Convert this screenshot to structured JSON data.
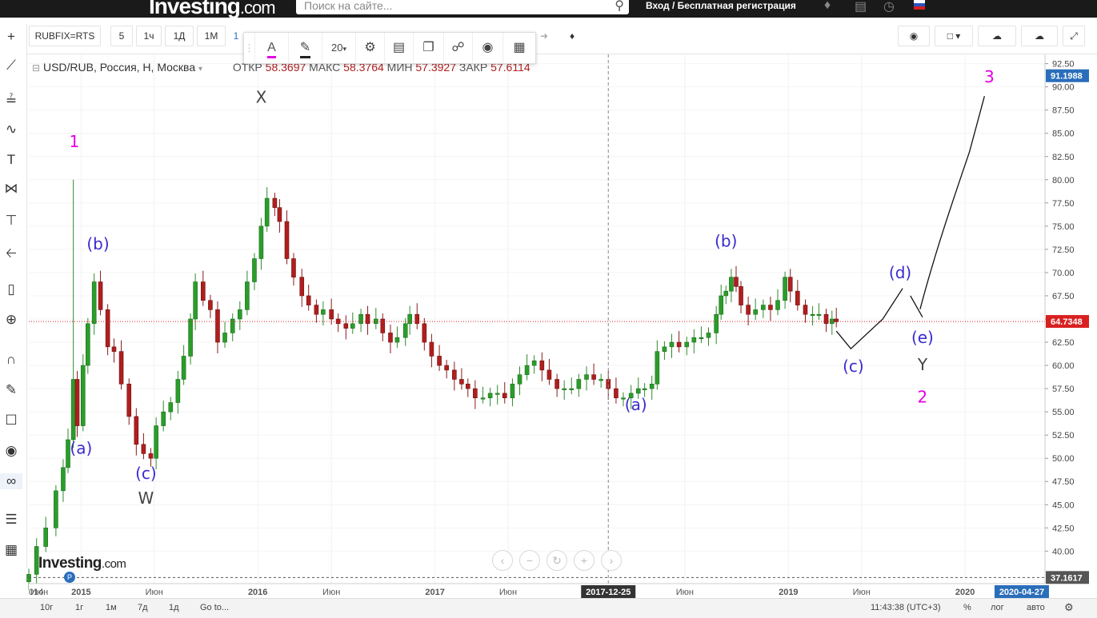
{
  "site": {
    "logo": "Investing",
    "logo_suffix": ".com",
    "search_placeholder": "Поиск на сайте...",
    "auth": "Вход / Бесплатная регистрация"
  },
  "toolbar": {
    "symbol": "RUBFIX=RTS",
    "intervals": [
      "5",
      "1ч",
      "1Д",
      "1М"
    ],
    "interval_partial": "1"
  },
  "drawing_tools": {
    "font_size": "20",
    "text_color": "#e600e6"
  },
  "legend": {
    "title": "USD/RUB, Россия, H, Москва",
    "open_label": "ОТКР",
    "open": "58.3697",
    "high_label": "МАКС",
    "high": "58.3764",
    "low_label": "МИН",
    "low": "57.3927",
    "close_label": "ЗАКР",
    "close": "57.6114"
  },
  "watermark": {
    "text": "Investing",
    "suffix": ".com",
    "badge": "P"
  },
  "bottom": {
    "ranges": [
      "10г",
      "1г",
      "1м",
      "7д",
      "1д"
    ],
    "goto": "Go to...",
    "time": "11:43:38 (UTC+3)",
    "pct": "%",
    "log": "лог",
    "auto": "авто"
  },
  "chart_data": {
    "type": "candlestick",
    "title": "",
    "y_range": [
      36.5,
      93.5
    ],
    "y_ticks": [
      40,
      42.5,
      45,
      47.5,
      50,
      52.5,
      55,
      57.5,
      60,
      62.5,
      65,
      67.5,
      70,
      72.5,
      75,
      77.5,
      80,
      82.5,
      85,
      87.5,
      90,
      92.5
    ],
    "y_badges": [
      {
        "value": 91.1988,
        "text": "91.1988",
        "color": "#2a6ebb"
      },
      {
        "value": 64.7348,
        "text": "64.7348",
        "color": "#d92020"
      },
      {
        "value": 37.1617,
        "text": "37.1617",
        "color": "#555555"
      }
    ],
    "current_price": 64.7348,
    "x_range": [
      "2014-09-15",
      "2020-06-14"
    ],
    "x_ticks": [
      {
        "date": "2014-09-15",
        "text": "014",
        "bold": false
      },
      {
        "date": "2014-07-01",
        "text": "Июн",
        "bold": false
      },
      {
        "date": "2015-01-01",
        "text": "2015",
        "bold": true
      },
      {
        "date": "2015-06-01",
        "text": "Июн",
        "bold": false
      },
      {
        "date": "2016-01-01",
        "text": "2016",
        "bold": true
      },
      {
        "date": "2016-06-01",
        "text": "Июн",
        "bold": false
      },
      {
        "date": "2017-01-01",
        "text": "2017",
        "bold": true
      },
      {
        "date": "2017-06-01",
        "text": "Июн",
        "bold": false
      },
      {
        "date": "2018-06-01",
        "text": "Июн",
        "bold": false
      },
      {
        "date": "2019-01-01",
        "text": "2019",
        "bold": true
      },
      {
        "date": "2019-06-01",
        "text": "Июн",
        "bold": false
      },
      {
        "date": "2020-01-01",
        "text": "2020",
        "bold": true
      }
    ],
    "x_badges": [
      {
        "date": "2017-12-25",
        "text": "2017-12-25",
        "color": "#333333"
      },
      {
        "date": "2020-04-27",
        "text": "2020-04-27",
        "color": "#2a6ebb"
      }
    ],
    "crosshair_date": "2017-12-25",
    "candles_weekly_close": [
      {
        "date": "2014-09-15",
        "v": 37.5
      },
      {
        "date": "2014-10-01",
        "v": 40.5
      },
      {
        "date": "2014-10-20",
        "v": 42.5
      },
      {
        "date": "2014-11-10",
        "v": 46.5
      },
      {
        "date": "2014-11-25",
        "v": 49.0
      },
      {
        "date": "2014-12-05",
        "v": 52.0
      },
      {
        "date": "2014-12-16",
        "v": 58.5
      },
      {
        "date": "2014-12-24",
        "v": 53.5
      },
      {
        "date": "2015-01-05",
        "v": 60.0
      },
      {
        "date": "2015-01-15",
        "v": 64.5
      },
      {
        "date": "2015-01-28",
        "v": 69.0
      },
      {
        "date": "2015-02-10",
        "v": 66.0
      },
      {
        "date": "2015-02-25",
        "v": 62.0
      },
      {
        "date": "2015-03-10",
        "v": 61.5
      },
      {
        "date": "2015-03-25",
        "v": 58.0
      },
      {
        "date": "2015-04-10",
        "v": 54.5
      },
      {
        "date": "2015-04-25",
        "v": 51.5
      },
      {
        "date": "2015-05-10",
        "v": 50.5
      },
      {
        "date": "2015-05-25",
        "v": 50.0
      },
      {
        "date": "2015-06-05",
        "v": 53.5
      },
      {
        "date": "2015-06-20",
        "v": 55.0
      },
      {
        "date": "2015-07-05",
        "v": 56.0
      },
      {
        "date": "2015-07-20",
        "v": 58.5
      },
      {
        "date": "2015-08-01",
        "v": 61.0
      },
      {
        "date": "2015-08-15",
        "v": 65.0
      },
      {
        "date": "2015-08-25",
        "v": 69.0
      },
      {
        "date": "2015-09-10",
        "v": 67.0
      },
      {
        "date": "2015-09-25",
        "v": 66.0
      },
      {
        "date": "2015-10-10",
        "v": 62.5
      },
      {
        "date": "2015-10-25",
        "v": 63.5
      },
      {
        "date": "2015-11-10",
        "v": 65.0
      },
      {
        "date": "2015-11-25",
        "v": 66.0
      },
      {
        "date": "2015-12-10",
        "v": 69.0
      },
      {
        "date": "2015-12-25",
        "v": 71.5
      },
      {
        "date": "2016-01-08",
        "v": 75.0
      },
      {
        "date": "2016-01-20",
        "v": 78.0
      },
      {
        "date": "2016-02-05",
        "v": 77.0
      },
      {
        "date": "2016-02-15",
        "v": 75.5
      },
      {
        "date": "2016-03-01",
        "v": 71.5
      },
      {
        "date": "2016-03-15",
        "v": 69.5
      },
      {
        "date": "2016-04-01",
        "v": 67.5
      },
      {
        "date": "2016-04-15",
        "v": 66.5
      },
      {
        "date": "2016-05-01",
        "v": 65.5
      },
      {
        "date": "2016-05-15",
        "v": 66.0
      },
      {
        "date": "2016-06-01",
        "v": 65.0
      },
      {
        "date": "2016-06-15",
        "v": 64.5
      },
      {
        "date": "2016-07-01",
        "v": 64.0
      },
      {
        "date": "2016-07-15",
        "v": 64.5
      },
      {
        "date": "2016-08-01",
        "v": 65.5
      },
      {
        "date": "2016-08-15",
        "v": 64.5
      },
      {
        "date": "2016-09-01",
        "v": 65.0
      },
      {
        "date": "2016-09-15",
        "v": 63.5
      },
      {
        "date": "2016-10-01",
        "v": 62.5
      },
      {
        "date": "2016-10-15",
        "v": 63.0
      },
      {
        "date": "2016-11-01",
        "v": 64.5
      },
      {
        "date": "2016-11-10",
        "v": 65.5
      },
      {
        "date": "2016-11-25",
        "v": 64.5
      },
      {
        "date": "2016-12-10",
        "v": 62.5
      },
      {
        "date": "2016-12-25",
        "v": 61.0
      },
      {
        "date": "2017-01-10",
        "v": 60.0
      },
      {
        "date": "2017-01-25",
        "v": 59.5
      },
      {
        "date": "2017-02-10",
        "v": 58.5
      },
      {
        "date": "2017-02-25",
        "v": 58.0
      },
      {
        "date": "2017-03-10",
        "v": 57.5
      },
      {
        "date": "2017-03-25",
        "v": 56.5
      },
      {
        "date": "2017-04-10",
        "v": 56.5
      },
      {
        "date": "2017-04-25",
        "v": 57.0
      },
      {
        "date": "2017-05-10",
        "v": 57.0
      },
      {
        "date": "2017-05-25",
        "v": 56.5
      },
      {
        "date": "2017-06-10",
        "v": 58.0
      },
      {
        "date": "2017-06-25",
        "v": 59.0
      },
      {
        "date": "2017-07-10",
        "v": 60.0
      },
      {
        "date": "2017-07-25",
        "v": 60.5
      },
      {
        "date": "2017-08-10",
        "v": 59.5
      },
      {
        "date": "2017-08-25",
        "v": 58.5
      },
      {
        "date": "2017-09-10",
        "v": 57.5
      },
      {
        "date": "2017-09-25",
        "v": 57.5
      },
      {
        "date": "2017-10-10",
        "v": 57.5
      },
      {
        "date": "2017-10-25",
        "v": 58.5
      },
      {
        "date": "2017-11-10",
        "v": 59.0
      },
      {
        "date": "2017-11-25",
        "v": 58.5
      },
      {
        "date": "2017-12-10",
        "v": 58.5
      },
      {
        "date": "2017-12-25",
        "v": 57.5
      },
      {
        "date": "2018-01-10",
        "v": 56.5
      },
      {
        "date": "2018-01-25",
        "v": 56.5
      },
      {
        "date": "2018-02-10",
        "v": 57.0
      },
      {
        "date": "2018-02-25",
        "v": 57.5
      },
      {
        "date": "2018-03-10",
        "v": 57.5
      },
      {
        "date": "2018-03-25",
        "v": 58.0
      },
      {
        "date": "2018-04-05",
        "v": 61.5
      },
      {
        "date": "2018-04-20",
        "v": 62.0
      },
      {
        "date": "2018-05-05",
        "v": 62.5
      },
      {
        "date": "2018-05-20",
        "v": 62.0
      },
      {
        "date": "2018-06-05",
        "v": 62.5
      },
      {
        "date": "2018-06-20",
        "v": 63.0
      },
      {
        "date": "2018-07-05",
        "v": 63.0
      },
      {
        "date": "2018-07-20",
        "v": 63.5
      },
      {
        "date": "2018-08-05",
        "v": 65.5
      },
      {
        "date": "2018-08-15",
        "v": 67.5
      },
      {
        "date": "2018-08-25",
        "v": 68.0
      },
      {
        "date": "2018-09-05",
        "v": 69.5
      },
      {
        "date": "2018-09-15",
        "v": 68.5
      },
      {
        "date": "2018-09-25",
        "v": 66.5
      },
      {
        "date": "2018-10-10",
        "v": 65.5
      },
      {
        "date": "2018-10-25",
        "v": 66.0
      },
      {
        "date": "2018-11-10",
        "v": 66.5
      },
      {
        "date": "2018-11-25",
        "v": 66.0
      },
      {
        "date": "2018-12-10",
        "v": 67.0
      },
      {
        "date": "2018-12-25",
        "v": 69.5
      },
      {
        "date": "2019-01-05",
        "v": 68.0
      },
      {
        "date": "2019-01-20",
        "v": 66.5
      },
      {
        "date": "2019-02-05",
        "v": 65.5
      },
      {
        "date": "2019-02-20",
        "v": 65.5
      },
      {
        "date": "2019-03-05",
        "v": 65.5
      },
      {
        "date": "2019-03-20",
        "v": 64.5
      },
      {
        "date": "2019-04-01",
        "v": 65.0
      },
      {
        "date": "2019-04-10",
        "v": 64.7
      }
    ],
    "price_spikes": [
      {
        "date": "2014-12-16",
        "high": 80.0,
        "low": 51.5
      },
      {
        "date": "2015-01-30",
        "high": 72.0,
        "low": 64.0
      },
      {
        "date": "2016-01-21",
        "high": 86.0,
        "low": 74.5
      }
    ],
    "wave_path": [
      {
        "date": "2019-04-10",
        "v": 63.7
      },
      {
        "date": "2019-05-10",
        "v": 61.8
      },
      {
        "date": "2019-07-15",
        "v": 65.0
      },
      {
        "date": "2019-08-25",
        "v": 68.3
      },
      {
        "date": "2019-09-10",
        "v": 67.5
      },
      {
        "date": "2019-10-05",
        "v": 65.2
      },
      {
        "date": "2019-10-30",
        "v": 72.0
      },
      {
        "date": "2019-12-05",
        "v": 77.5
      },
      {
        "date": "2020-01-10",
        "v": 83.0
      },
      {
        "date": "2020-02-10",
        "v": 89.0
      }
    ],
    "annotations": [
      {
        "text": "1",
        "date": "2014-12-18",
        "v": 83.5,
        "color": "#e600e6"
      },
      {
        "text": "(b)",
        "date": "2015-02-05",
        "v": 72.5,
        "color": "#3a2ad0"
      },
      {
        "text": "(a)",
        "date": "2015-01-01",
        "v": 50.5,
        "color": "#3a2ad0"
      },
      {
        "text": "(c)",
        "date": "2015-05-15",
        "v": 47.8,
        "color": "#3a2ad0"
      },
      {
        "text": "W",
        "date": "2015-05-15",
        "v": 45.1,
        "color": "#444444"
      },
      {
        "text": "X",
        "date": "2016-01-08",
        "v": 88.3,
        "color": "#444444"
      },
      {
        "text": "(a)",
        "date": "2018-02-20",
        "v": 55.2,
        "color": "#3a2ad0"
      },
      {
        "text": "(b)",
        "date": "2018-08-25",
        "v": 72.8,
        "color": "#3a2ad0"
      },
      {
        "text": "(c)",
        "date": "2019-05-15",
        "v": 59.3,
        "color": "#3a2ad0"
      },
      {
        "text": "(d)",
        "date": "2019-08-20",
        "v": 69.4,
        "color": "#3a2ad0"
      },
      {
        "text": "(e)",
        "date": "2019-10-05",
        "v": 62.4,
        "color": "#3a2ad0"
      },
      {
        "text": "Y",
        "date": "2019-10-05",
        "v": 59.5,
        "color": "#444444"
      },
      {
        "text": "2",
        "date": "2019-10-05",
        "v": 56.0,
        "color": "#e600e6"
      },
      {
        "text": "3",
        "date": "2020-02-20",
        "v": 90.5,
        "color": "#e600e6"
      }
    ]
  }
}
